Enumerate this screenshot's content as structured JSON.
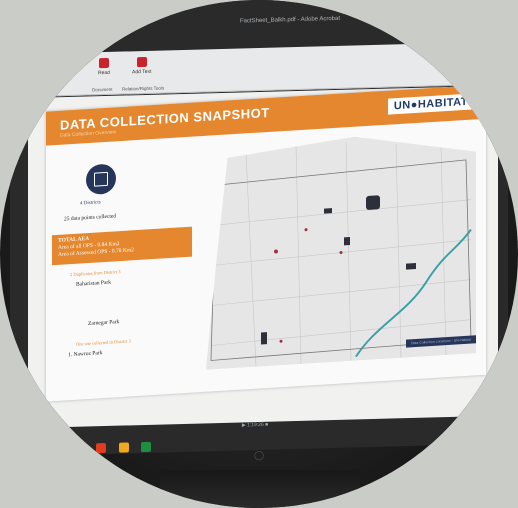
{
  "window": {
    "title": "FactSheet_Balkh.pdf - Adobe Acrobat"
  },
  "ribbon": {
    "items": [
      {
        "label": "Read"
      },
      {
        "label": "Add Text"
      }
    ],
    "groups": [
      "Document",
      "Relation/Rights Tools"
    ]
  },
  "slide": {
    "title": "DATA COLLECTION SNAPSHOT",
    "subtitle": "Data Collection Overview",
    "logo": "UN●HABITAT",
    "districts": "4 Districts",
    "points_collected": "25 data points collected",
    "area_box": {
      "total": "TOTAL AEA",
      "line1": "Area of all OPS - 0.84 Km2",
      "line2": "Area of Assessed OPS - 0.78 Km2"
    },
    "note1": "2 Duplicates from District 3",
    "park1": "Baharistan Park",
    "park2": "Zarnegar Park",
    "note2": "One site collected in District 3",
    "park3": "1.  Nawroz Park",
    "map_footer": "Data Collection Locations - UN-Habitat"
  },
  "player": {
    "time": "1:19:26"
  },
  "colors": {
    "accent": "#e4872f",
    "navy": "#25365a",
    "taskbar_icons": [
      "#1e6fc5",
      "#e23b1f",
      "#f2a81d",
      "#1e8f3f"
    ]
  },
  "icons": [
    "pdf-icon",
    "add-text-icon",
    "districts-icon",
    "play-icon",
    "stop-icon"
  ]
}
